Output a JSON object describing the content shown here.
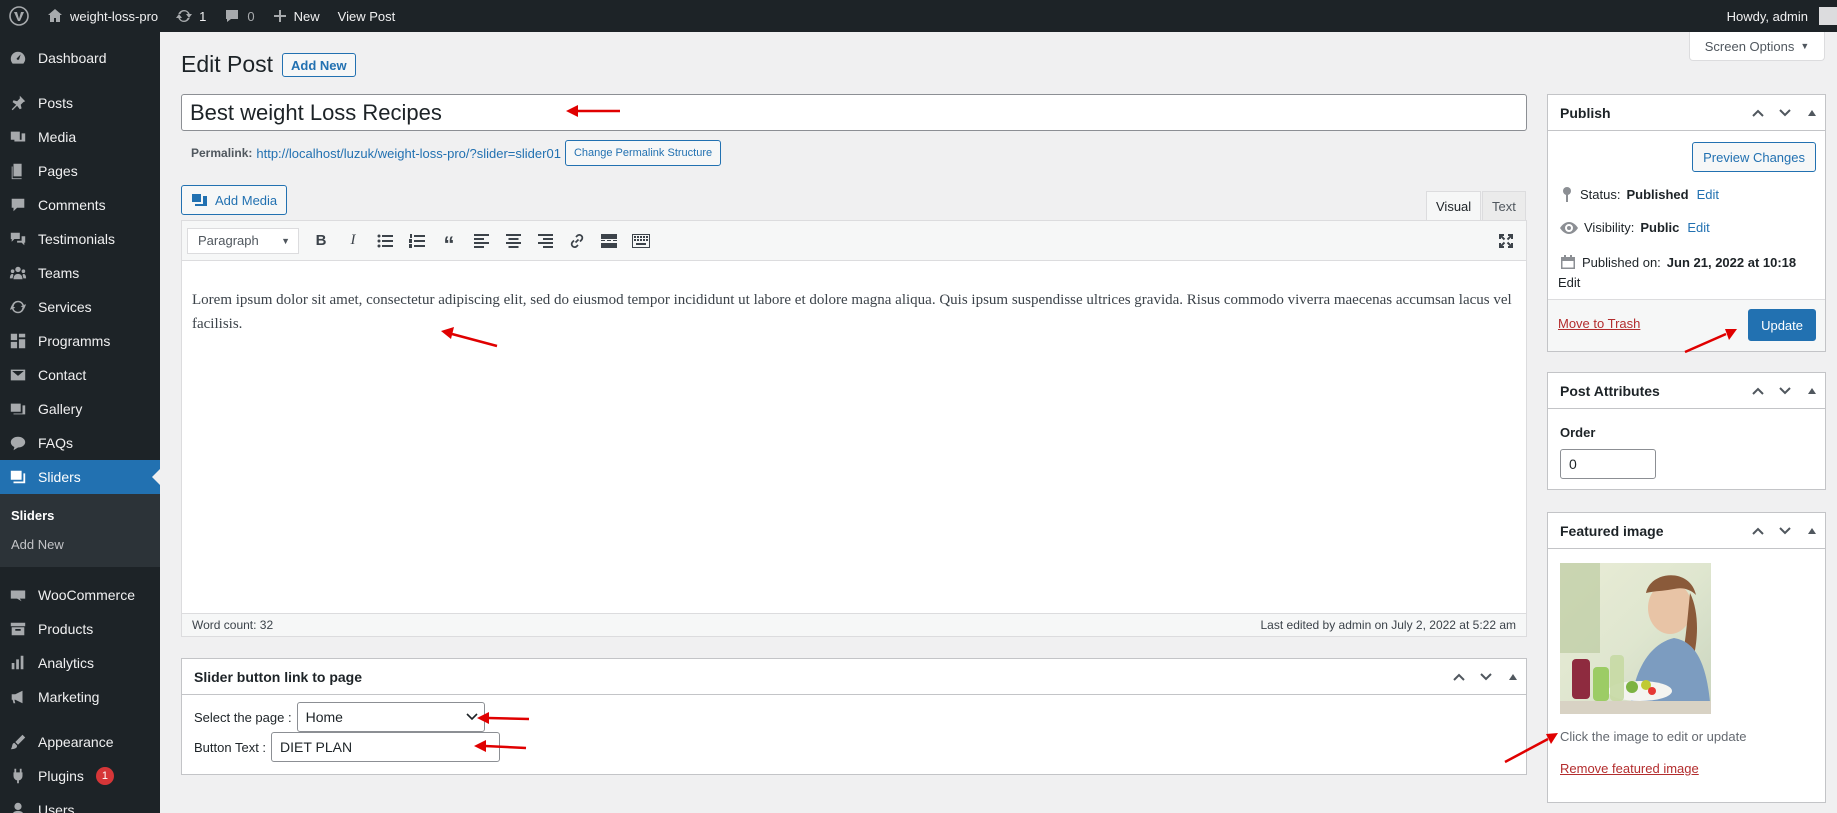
{
  "adminbar": {
    "site_name": "weight-loss-pro",
    "updates_count": "1",
    "comments_count": "0",
    "new_label": "New",
    "view_post_label": "View Post",
    "howdy": "Howdy, admin"
  },
  "sidebar": {
    "items": [
      {
        "label": "Dashboard",
        "icon": "dashboard-icon"
      },
      {
        "label": "Posts",
        "icon": "pin-icon"
      },
      {
        "label": "Media",
        "icon": "media-icon"
      },
      {
        "label": "Pages",
        "icon": "pages-icon"
      },
      {
        "label": "Comments",
        "icon": "comment-icon"
      },
      {
        "label": "Testimonials",
        "icon": "testimonial-icon"
      },
      {
        "label": "Teams",
        "icon": "groups-icon"
      },
      {
        "label": "Services",
        "icon": "services-icon"
      },
      {
        "label": "Programms",
        "icon": "grid-icon"
      },
      {
        "label": "Contact",
        "icon": "email-icon"
      },
      {
        "label": "Gallery",
        "icon": "gallery-icon"
      },
      {
        "label": "FAQs",
        "icon": "chat-icon"
      },
      {
        "label": "Sliders",
        "icon": "slides-icon"
      }
    ],
    "submenu": [
      "Sliders",
      "Add New"
    ],
    "items2": [
      {
        "label": "WooCommerce",
        "icon": "woo-icon"
      },
      {
        "label": "Products",
        "icon": "archive-icon"
      },
      {
        "label": "Analytics",
        "icon": "chart-icon"
      },
      {
        "label": "Marketing",
        "icon": "megaphone-icon"
      }
    ],
    "items3": [
      {
        "label": "Appearance",
        "icon": "brush-icon"
      },
      {
        "label": "Plugins",
        "icon": "plugin-icon",
        "badge": "1"
      },
      {
        "label": "Users",
        "icon": "users-icon"
      }
    ]
  },
  "screen_options_label": "Screen Options",
  "page": {
    "title": "Edit Post",
    "add_new": "Add New",
    "post_title": "Best weight Loss Recipes",
    "permalink_label": "Permalink:",
    "permalink_url": "http://localhost/luzuk/weight-loss-pro/?slider=slider01",
    "change_permalink": "Change Permalink Structure"
  },
  "editor": {
    "add_media": "Add Media",
    "tab_visual": "Visual",
    "tab_text": "Text",
    "format": "Paragraph",
    "content": "Lorem ipsum dolor sit amet, consectetur adipiscing elit, sed do eiusmod tempor incididunt ut labore et dolore magna aliqua. Quis ipsum suspendisse ultrices gravida. Risus commodo viverra maecenas accumsan lacus vel facilisis.",
    "word_count": "Word count: 32",
    "last_edited": "Last edited by admin on July 2, 2022 at 5:22 am"
  },
  "slider_box": {
    "title": "Slider button link to page",
    "select_label": "Select the page :",
    "select_value": "Home",
    "button_text_label": "Button Text :",
    "button_text_value": "DIET PLAN"
  },
  "publish": {
    "title": "Publish",
    "preview": "Preview Changes",
    "status_label": "Status:",
    "status_value": "Published",
    "visibility_label": "Visibility:",
    "visibility_value": "Public",
    "published_label": "Published on:",
    "published_value": "Jun 21, 2022 at 10:18",
    "edit": "Edit",
    "move_to_trash": "Move to Trash",
    "update": "Update"
  },
  "attributes": {
    "title": "Post Attributes",
    "order_label": "Order",
    "order_value": "0"
  },
  "featured": {
    "title": "Featured image",
    "hint": "Click the image to edit or update",
    "remove": "Remove featured image"
  },
  "colors": {
    "accent": "#2271b1",
    "sidebar_bg": "#1d2327",
    "annotation": "#e00000"
  }
}
